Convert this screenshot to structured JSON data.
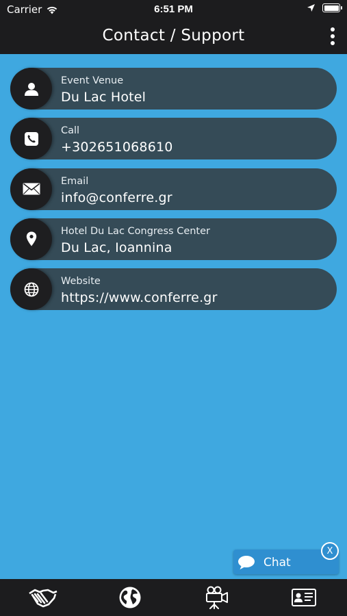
{
  "status_bar": {
    "carrier": "Carrier",
    "time": "6:51 PM",
    "icons": [
      "wifi-icon",
      "location-arrow-icon",
      "battery-icon"
    ]
  },
  "header": {
    "title": "Contact / Support",
    "menu_icon": "more-vertical-icon"
  },
  "contacts": [
    {
      "icon": "person-icon",
      "label": "Event Venue",
      "value": "Du Lac Hotel"
    },
    {
      "icon": "phone-icon",
      "label": "Call",
      "value": "+302651068610"
    },
    {
      "icon": "envelope-icon",
      "label": "Email",
      "value": "info@conferre.gr"
    },
    {
      "icon": "map-pin-icon",
      "label": "Hotel Du Lac Congress Center",
      "value": "Du Lac, Ioannina"
    },
    {
      "icon": "globe-icon",
      "label": "Website",
      "value": "https://www.conferre.gr"
    }
  ],
  "chat_widget": {
    "label": "Chat",
    "close_label": "X"
  },
  "tab_bar": {
    "tabs": [
      "handshake-icon",
      "globe-icon",
      "video-camera-icon",
      "id-card-icon"
    ]
  },
  "colors": {
    "background": "#3fa8e0",
    "bars": "#1c1c1e",
    "pill": "#354b57",
    "icon_circle": "#1e1e20",
    "chat": "#2f8fd0"
  }
}
